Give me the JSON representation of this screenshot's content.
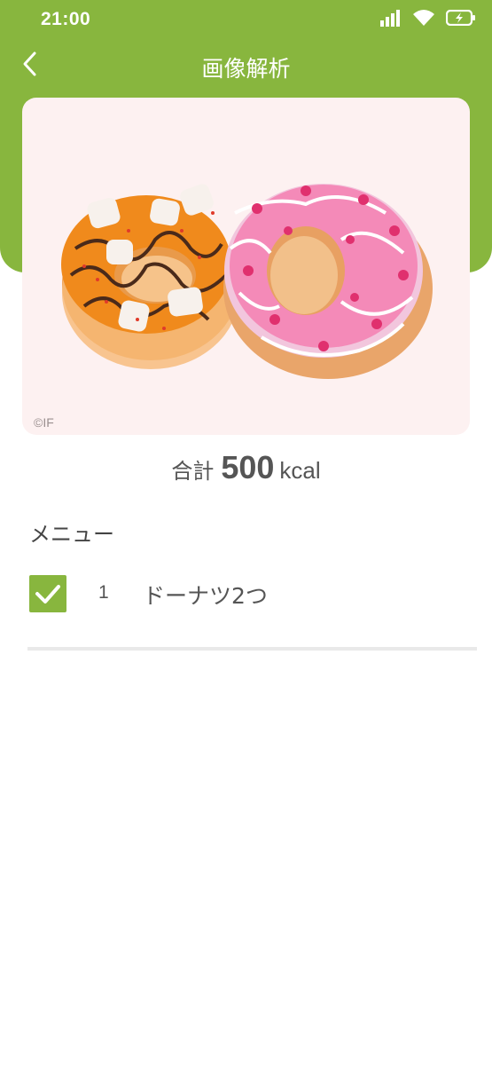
{
  "status_bar": {
    "time": "21:00",
    "icons": [
      "signal-icon",
      "wifi-icon",
      "battery-charging-icon"
    ]
  },
  "header": {
    "title": "画像解析",
    "back_icon": "chevron-left-icon"
  },
  "photo": {
    "subject": "two donuts",
    "credit": "©IF"
  },
  "total": {
    "label": "合計",
    "value": "500",
    "unit": "kcal"
  },
  "menu": {
    "heading": "メニュー",
    "items": [
      {
        "checked": true,
        "number": "1",
        "name": "ドーナツ2つ"
      }
    ]
  },
  "colors": {
    "accent": "#88b63e",
    "photo_background": "#fdf1f1",
    "divider": "#e9e9e9"
  }
}
